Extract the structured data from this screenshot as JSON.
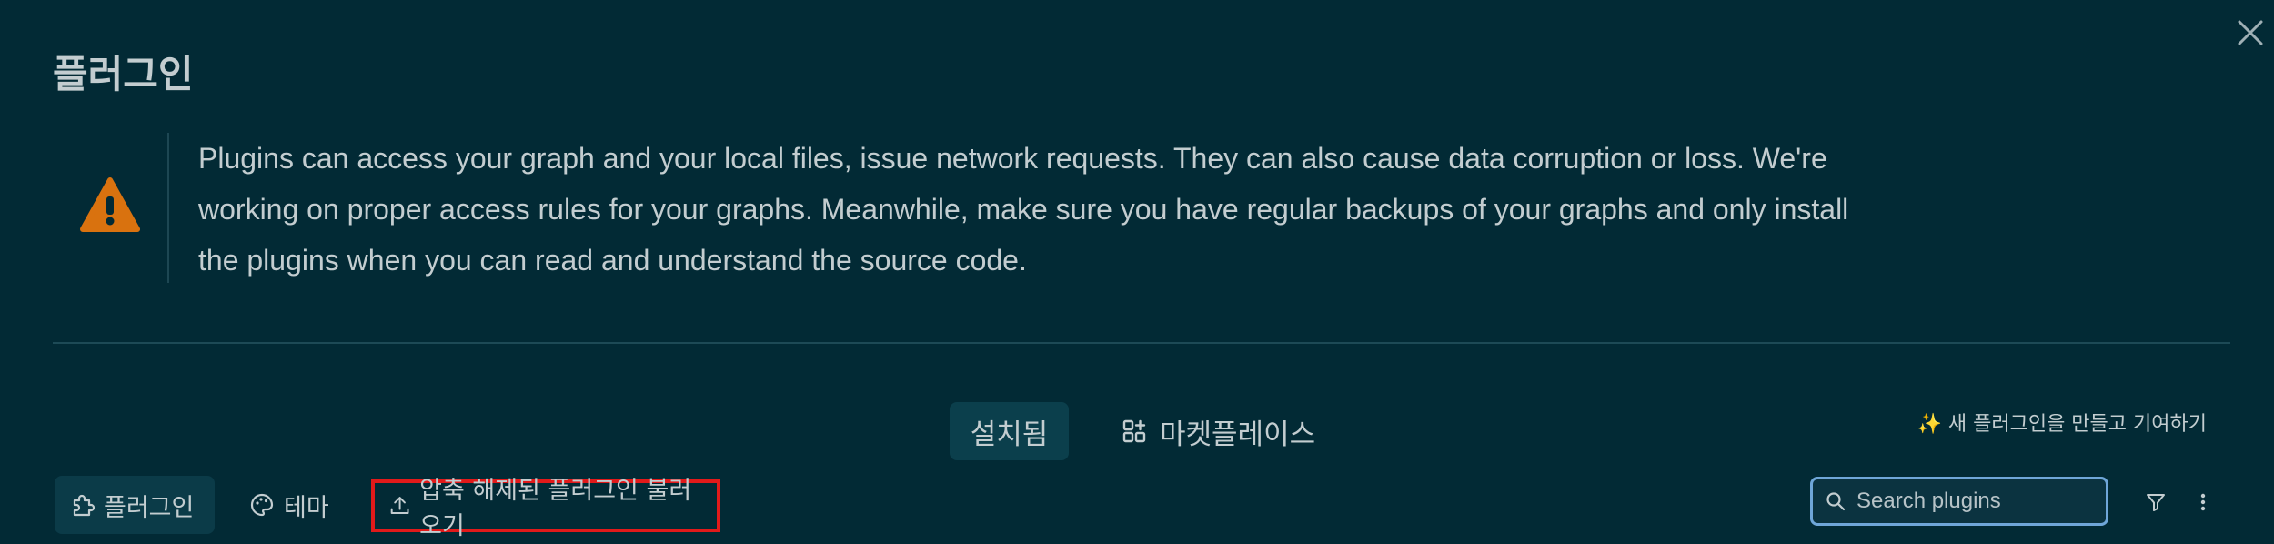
{
  "dialog": {
    "title": "플러그인",
    "close_icon": "close-icon"
  },
  "warning": {
    "icon": "warning-triangle-icon",
    "text": "Plugins can access your graph and your local files, issue network requests. They can also cause data corruption or loss. We're working on proper access rules for your graphs. Meanwhile, make sure you have regular backups of your graphs and only install the plugins when you can read and understand the source code."
  },
  "tabs": {
    "installed": "설치됨",
    "marketplace": "마켓플레이스"
  },
  "contribute_link": "✨ 새 플러그인을 만들고 기여하기",
  "toolbar": {
    "plugins_label": "플러그인",
    "themes_label": "테마",
    "load_unpacked_label": "압축 해제된 플러그인 불러오기",
    "search_placeholder": "Search plugins",
    "search_value": ""
  },
  "colors": {
    "background": "#022a35",
    "highlight": "#e11a1a",
    "warning": "#d9720f"
  }
}
